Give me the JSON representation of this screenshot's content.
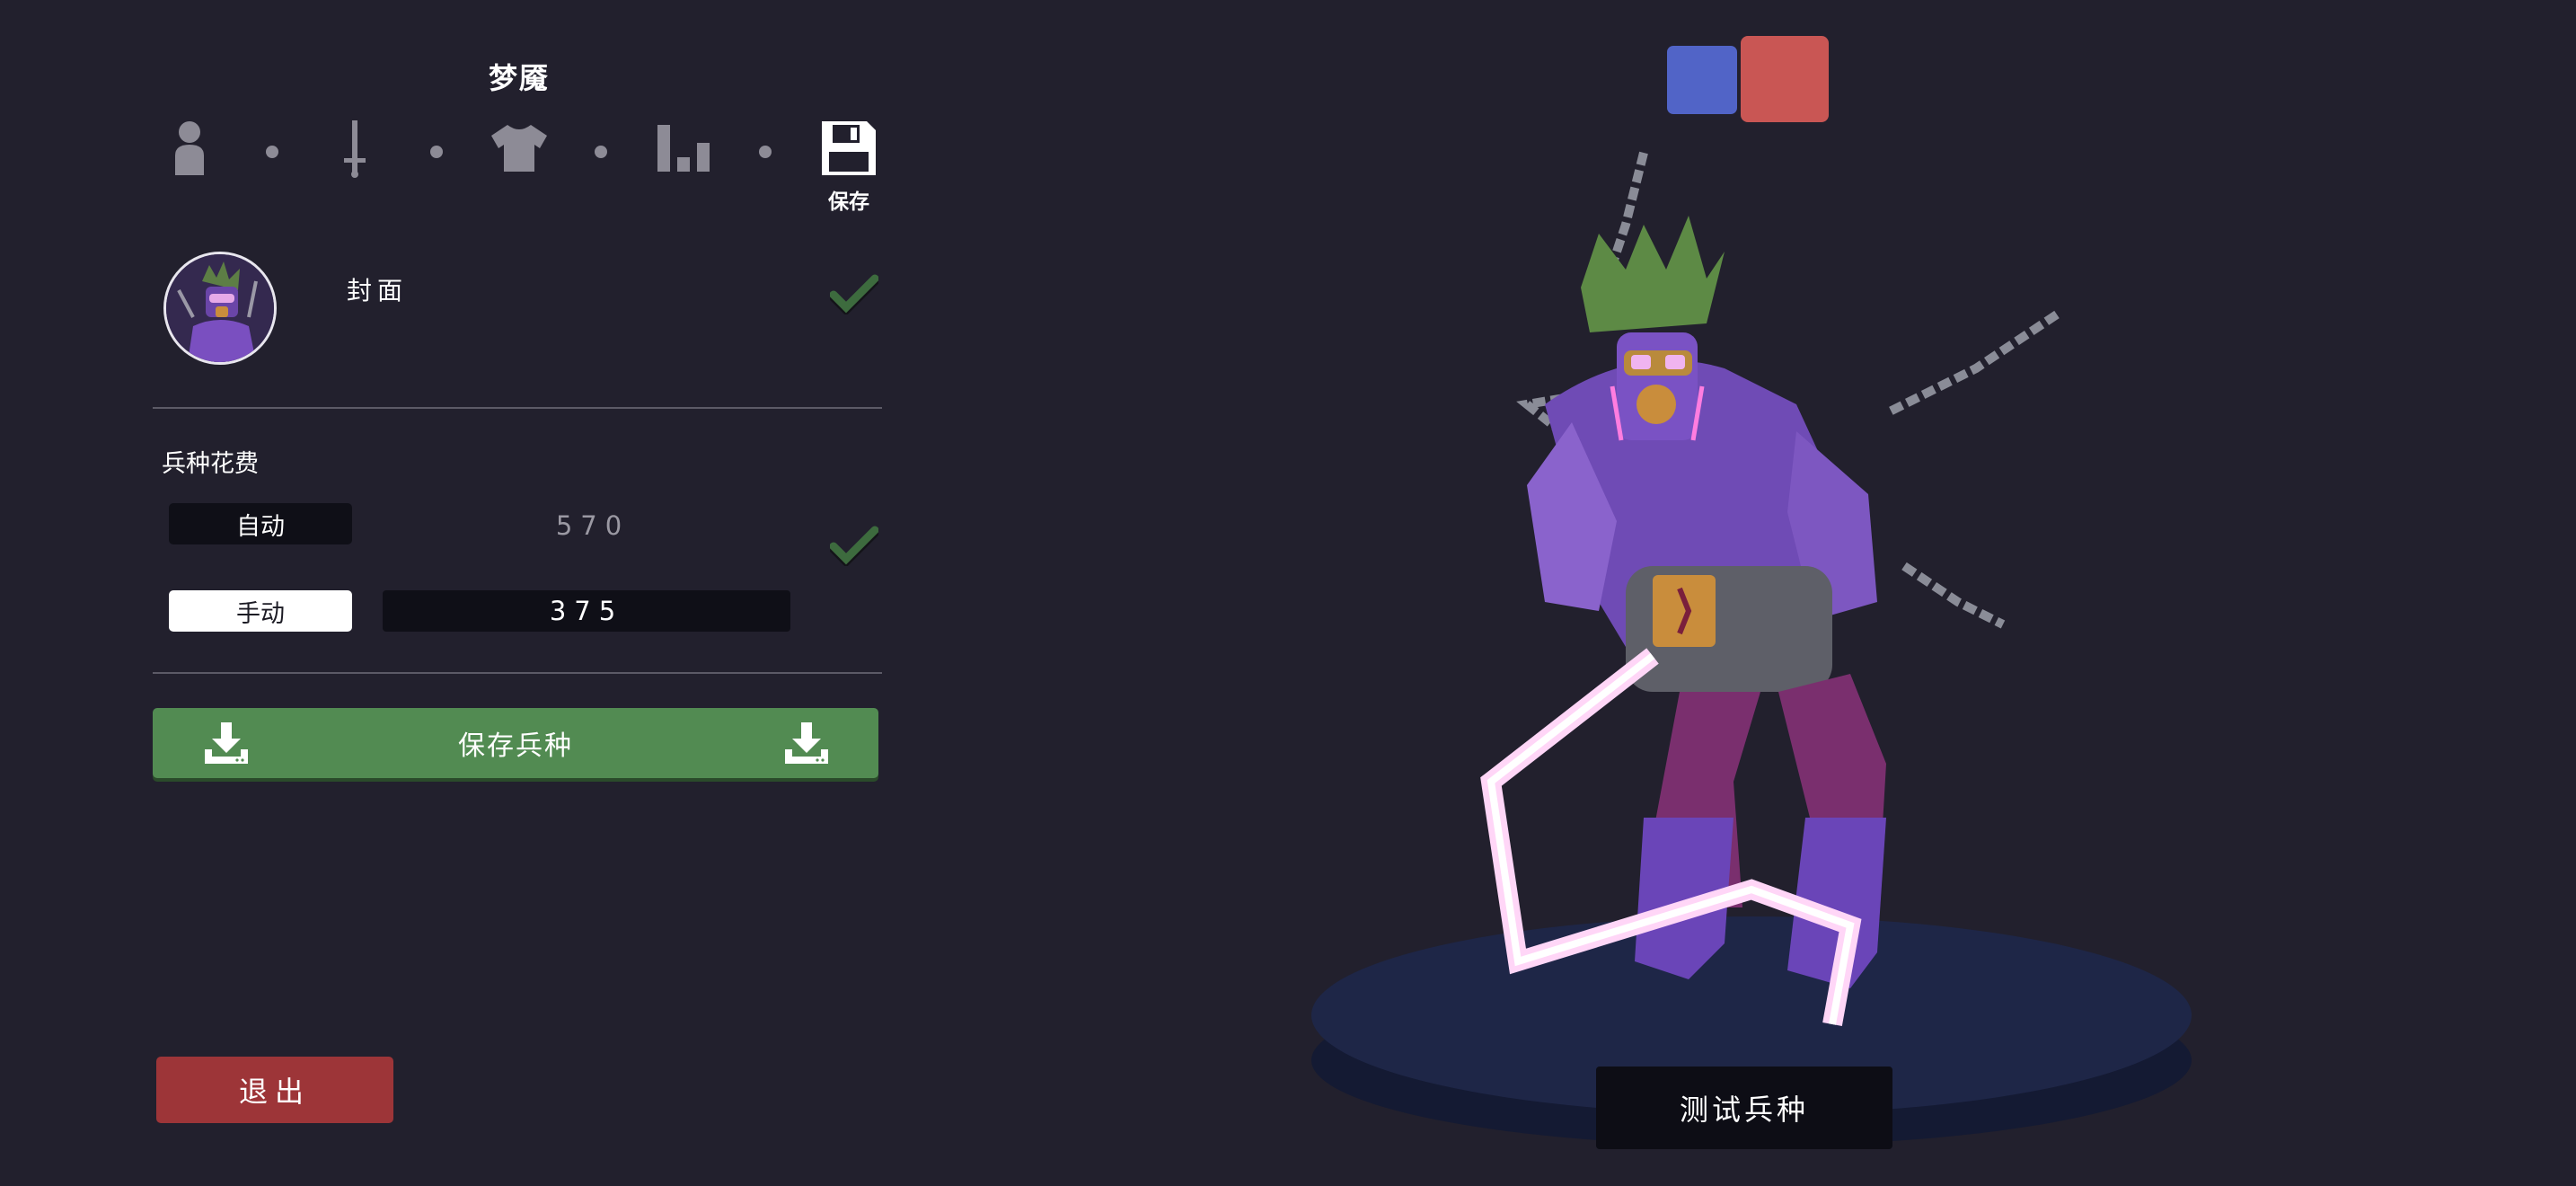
{
  "unit": {
    "name": "梦魇"
  },
  "steps": {
    "icons": [
      "person-icon",
      "sword-icon",
      "shirt-icon",
      "stats-icon",
      "floppy-disk-icon"
    ],
    "save_label": "保存"
  },
  "cover": {
    "label": "封面",
    "checked": true
  },
  "cost": {
    "title": "兵种花费",
    "auto_label": "自动",
    "auto_value": "570",
    "manual_label": "手动",
    "manual_value": "375",
    "checked": true
  },
  "actions": {
    "save_unit": "保存兵种",
    "exit": "退出",
    "test_unit": "测试兵种"
  },
  "colors": {
    "background": "#22202d",
    "save_green": "#528b52",
    "exit_red": "#9d3538",
    "team_blue": "#5164c7",
    "team_red": "#c95654"
  }
}
